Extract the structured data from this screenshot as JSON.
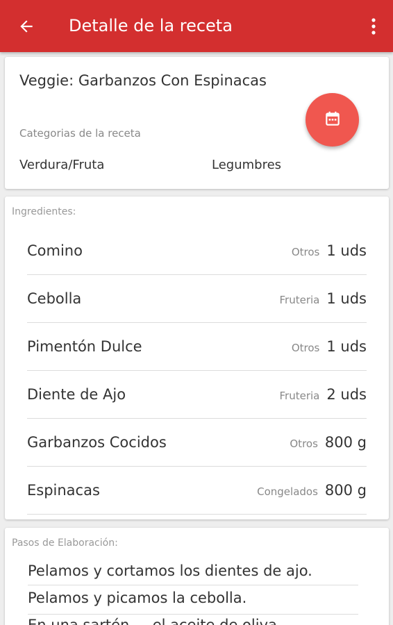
{
  "appbar": {
    "title": "Detalle de la receta",
    "back_icon": "arrow-back-icon",
    "menu_icon": "more-vert-icon",
    "color": "#d32f2f"
  },
  "recipe": {
    "title": "Veggie: Garbanzos Con Espinacas",
    "categories_label": "Categorias de la receta",
    "categories": [
      "Verdura/Fruta",
      "Legumbres"
    ],
    "fab_icon": "calendar-icon",
    "fab_color": "#f0574f"
  },
  "ingredients": {
    "label": "Ingredientes:",
    "items": [
      {
        "name": "Comino",
        "category": "Otros",
        "quantity": "1 uds"
      },
      {
        "name": "Cebolla",
        "category": "Fruteria",
        "quantity": "1 uds"
      },
      {
        "name": "Pimentón Dulce",
        "category": "Otros",
        "quantity": "1 uds"
      },
      {
        "name": "Diente de Ajo",
        "category": "Fruteria",
        "quantity": "2 uds"
      },
      {
        "name": "Garbanzos Cocidos",
        "category": "Otros",
        "quantity": "800 g"
      },
      {
        "name": "Espinacas",
        "category": "Congelados",
        "quantity": "800 g"
      }
    ]
  },
  "steps": {
    "label": "Pasos de Elaboración:",
    "items": [
      "Pelamos y cortamos los dientes de ajo.",
      "Pelamos y picamos la cebolla.",
      "En una sartén ... el aceite de oliva"
    ]
  }
}
